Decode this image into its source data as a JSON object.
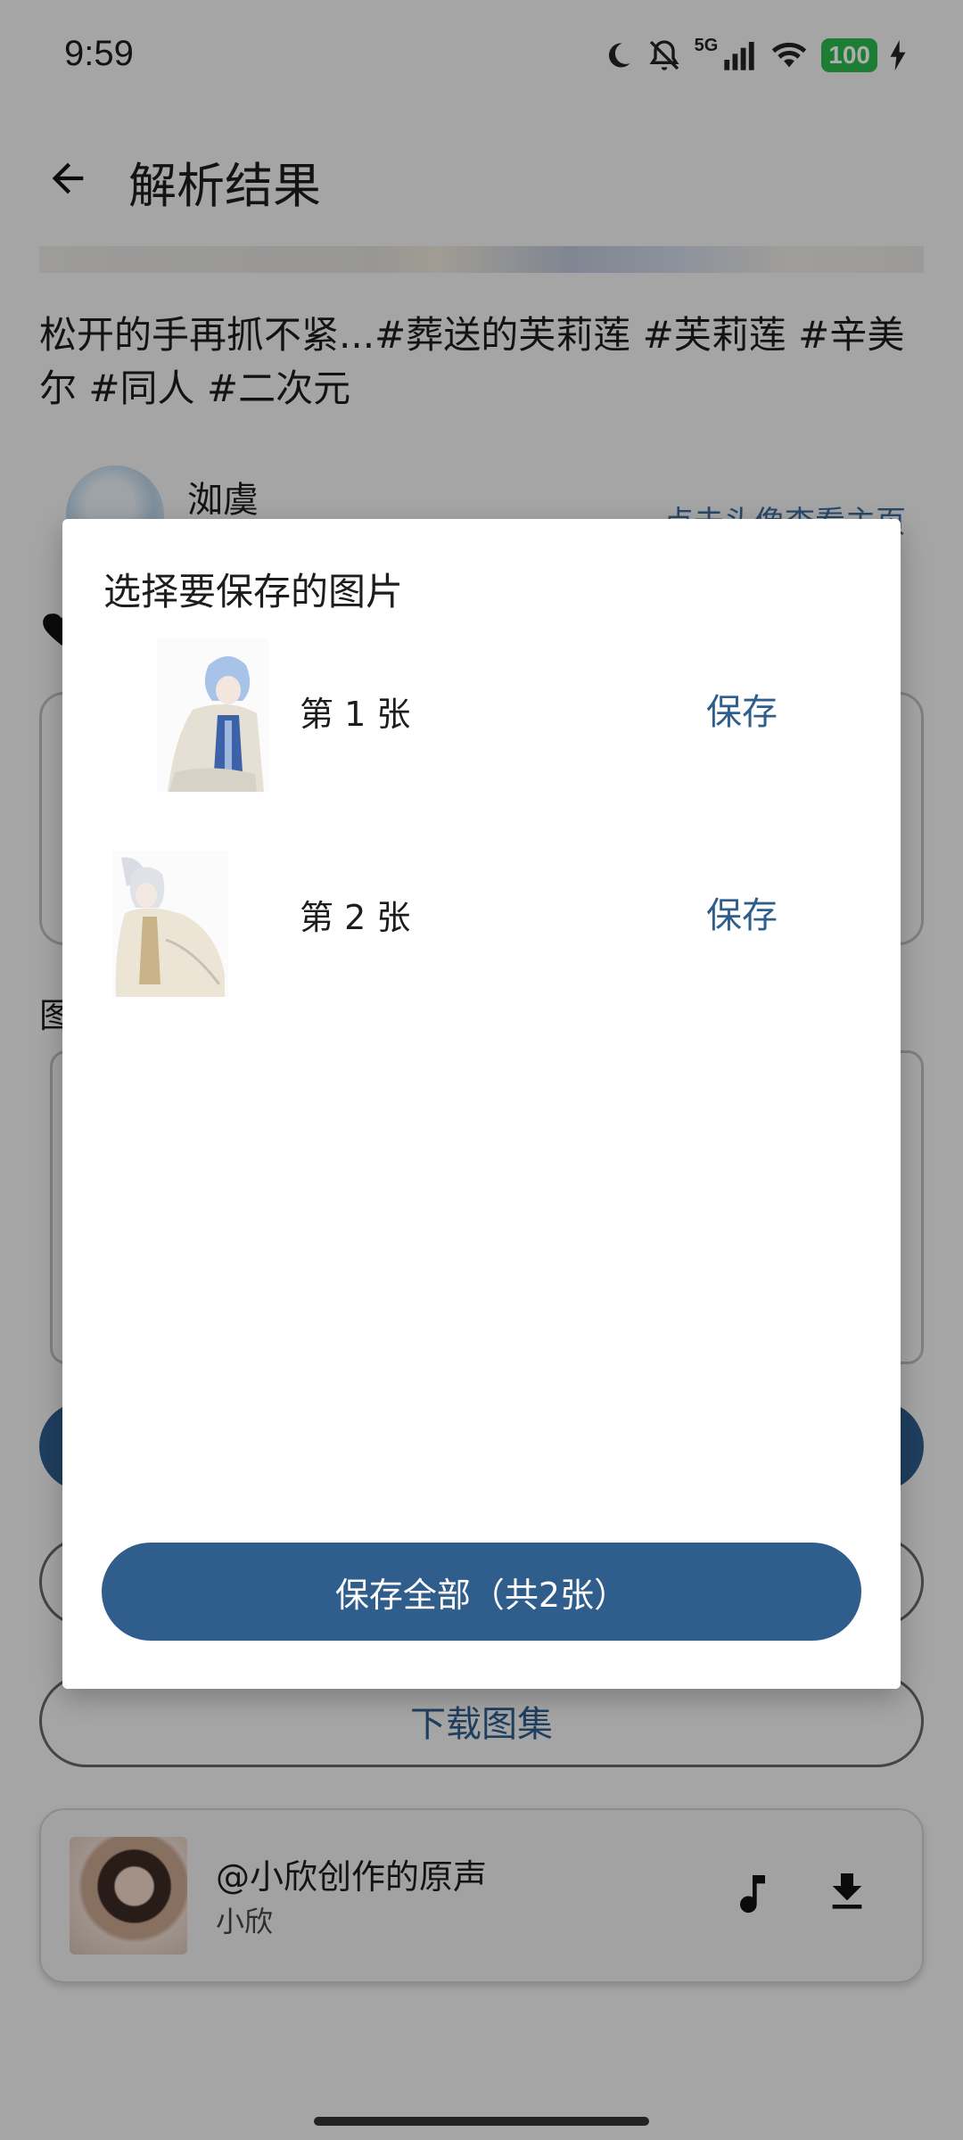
{
  "status_bar": {
    "time": "9:59",
    "network": "5G",
    "battery": "100"
  },
  "app_bar": {
    "title": "解析结果"
  },
  "post": {
    "description": "松开的手再抓不紧...#葬送的芙莉莲 #芙莉莲 #辛美尔 #同人 #二次元",
    "author_name": "洳虞",
    "author_link": "点击头像查看主页",
    "section_label": "图"
  },
  "buttons": {
    "download_gallery": "下载图集"
  },
  "music": {
    "title": "@小欣创作的原声",
    "artist": "小欣"
  },
  "dialog": {
    "title": "选择要保存的图片",
    "items": [
      {
        "label": "第 1 张",
        "action": "保存"
      },
      {
        "label": "第 2 张",
        "action": "保存"
      }
    ],
    "save_all": "保存全部（共2张）"
  },
  "colors": {
    "accent": "#2f5d8c",
    "battery": "#2db84d",
    "scrim": "rgba(0,0,0,0.32)"
  },
  "icons": [
    "back-arrow-icon",
    "moon-icon",
    "bell-off-icon",
    "signal-icon",
    "wifi-icon",
    "charging-icon",
    "heart-icon",
    "music-note-icon",
    "download-icon"
  ]
}
